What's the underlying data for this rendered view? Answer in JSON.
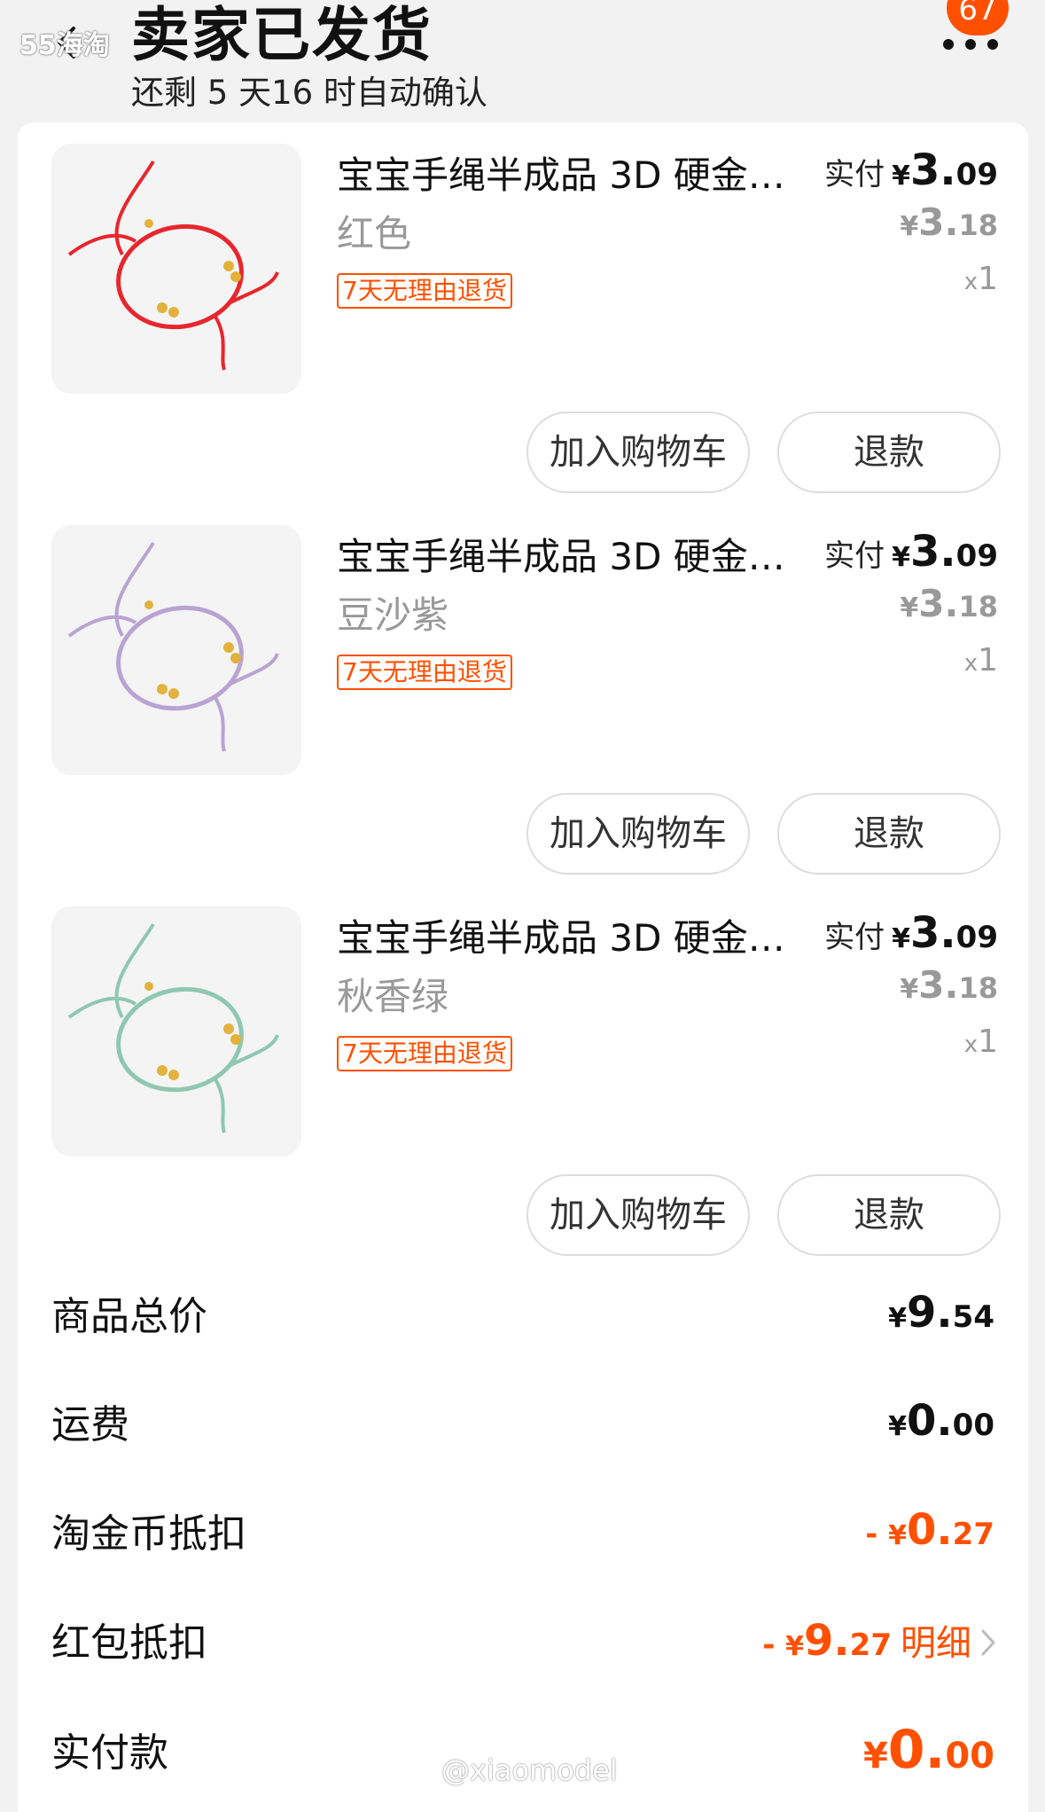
{
  "header": {
    "watermark": "55海淘",
    "title": "卖家已发货",
    "subtitle": "还剩 5 天16 时自动确认",
    "badge_count": "67"
  },
  "items": [
    {
      "title": "宝宝手绳半成品 3D 硬金手链编织绳",
      "spec": "红色",
      "return_tag": "7天无理由退货",
      "paid_label": "实付",
      "paid_currency": "¥",
      "paid_int": "3.",
      "paid_dec": "09",
      "orig_currency": "¥",
      "orig_int": "3.",
      "orig_dec": "18",
      "qty_x": "x",
      "qty": "1",
      "cart_button": "加入购物车",
      "refund_button": "退款",
      "rope_color": "#e8262d"
    },
    {
      "title": "宝宝手绳半成品 3D 硬金手链编织绳",
      "spec": "豆沙紫",
      "return_tag": "7天无理由退货",
      "paid_label": "实付",
      "paid_currency": "¥",
      "paid_int": "3.",
      "paid_dec": "09",
      "orig_currency": "¥",
      "orig_int": "3.",
      "orig_dec": "18",
      "qty_x": "x",
      "qty": "1",
      "cart_button": "加入购物车",
      "refund_button": "退款",
      "rope_color": "#b9a3d3"
    },
    {
      "title": "宝宝手绳半成品 3D 硬金手链编织绳",
      "spec": "秋香绿",
      "return_tag": "7天无理由退货",
      "paid_label": "实付",
      "paid_currency": "¥",
      "paid_int": "3.",
      "paid_dec": "09",
      "orig_currency": "¥",
      "orig_int": "3.",
      "orig_dec": "18",
      "qty_x": "x",
      "qty": "1",
      "cart_button": "加入购物车",
      "refund_button": "退款",
      "rope_color": "#8fc7b2"
    }
  ],
  "summary": {
    "goods_total": {
      "label": "商品总价",
      "currency": "¥",
      "int": "9.",
      "dec": "54"
    },
    "shipping": {
      "label": "运费",
      "currency": "¥",
      "int": "0.",
      "dec": "00"
    },
    "coin_deduct": {
      "label": "淘金币抵扣",
      "prefix": "- ",
      "currency": "¥",
      "int": "0.",
      "dec": "27"
    },
    "redpack_deduct": {
      "label": "红包抵扣",
      "prefix": "- ",
      "currency": "¥",
      "int": "9.",
      "dec": "27",
      "detail": "明细"
    },
    "actual_paid": {
      "label": "实付款",
      "currency": "¥",
      "int": "0.",
      "dec": "00"
    }
  },
  "watermark_bottom": "@xiaomodel",
  "colors": {
    "accent": "#ff5000",
    "gold": "#e3b23c"
  }
}
